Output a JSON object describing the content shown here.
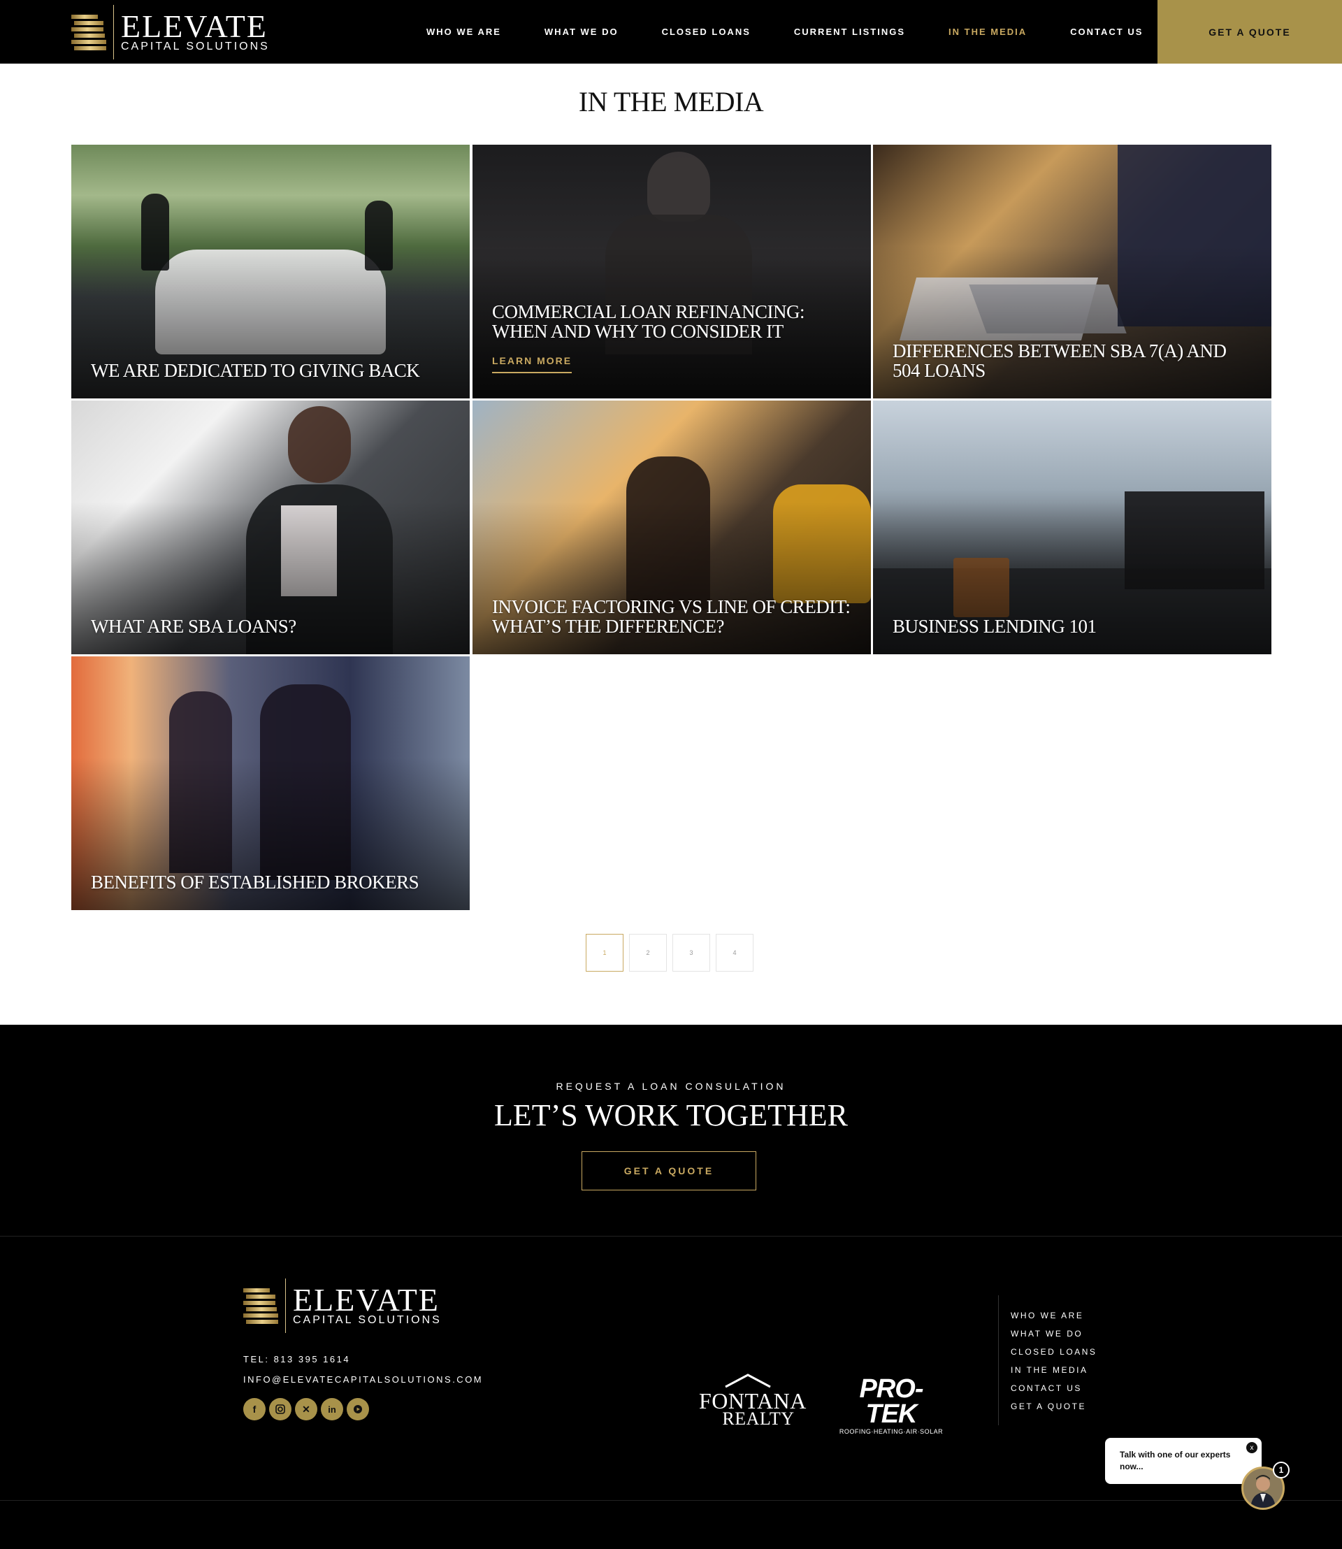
{
  "header": {
    "logo_name": "ELEVATE",
    "logo_tagline": "CAPITAL SOLUTIONS",
    "nav": [
      {
        "label": "WHO WE ARE"
      },
      {
        "label": "WHAT WE DO"
      },
      {
        "label": "CLOSED LOANS"
      },
      {
        "label": "CURRENT LISTINGS"
      },
      {
        "label": "IN THE MEDIA"
      },
      {
        "label": "CONTACT US"
      }
    ],
    "active_nav": "IN THE MEDIA",
    "cta_label": "GET A QUOTE"
  },
  "page": {
    "title": "IN THE MEDIA"
  },
  "articles": [
    {
      "title": "WE ARE DEDICATED TO GIVING BACK"
    },
    {
      "title": "COMMERCIAL LOAN REFINANCING: WHEN AND WHY TO CONSIDER IT",
      "link": "LEARN MORE"
    },
    {
      "title": "DIFFERENCES BETWEEN SBA 7(A) AND 504 LOANS"
    },
    {
      "title": "WHAT ARE SBA LOANS?"
    },
    {
      "title": "INVOICE FACTORING VS LINE OF CREDIT: WHAT’S THE DIFFERENCE?"
    },
    {
      "title": "BUSINESS LENDING 101"
    },
    {
      "title": "BENEFITS OF ESTABLISHED BROKERS"
    }
  ],
  "pagination": {
    "pages": [
      "1",
      "2",
      "3",
      "4"
    ],
    "current": "1"
  },
  "cta": {
    "kicker": "REQUEST A LOAN CONSULATION",
    "title": "LET’S WORK TOGETHER",
    "button": "GET A QUOTE"
  },
  "footer": {
    "logo_name": "ELEVATE",
    "logo_tagline": "CAPITAL SOLUTIONS",
    "tel": "TEL: 813 395 1614",
    "email": "INFO@ELEVATECAPITALSOLUTIONS.COM",
    "socials": [
      "facebook-icon",
      "instagram-icon",
      "x-icon",
      "linkedin-icon",
      "youtube-icon"
    ],
    "partners": [
      {
        "name_line1": "FONTANA",
        "name_line2": "REALTY"
      },
      {
        "name": "PRO-TEK",
        "sub": "ROOFING·HEATING·AIR·SOLAR"
      }
    ],
    "links": [
      "WHO WE ARE",
      "WHAT WE DO",
      "CLOSED LOANS",
      "IN THE MEDIA",
      "CONTACT US",
      "GET A QUOTE"
    ]
  },
  "chat": {
    "message": "Talk with one of our experts now...",
    "close": "x",
    "badge": "1"
  },
  "colors": {
    "gold": "#c9a961",
    "gold_button": "#a8924a",
    "black": "#000000"
  }
}
